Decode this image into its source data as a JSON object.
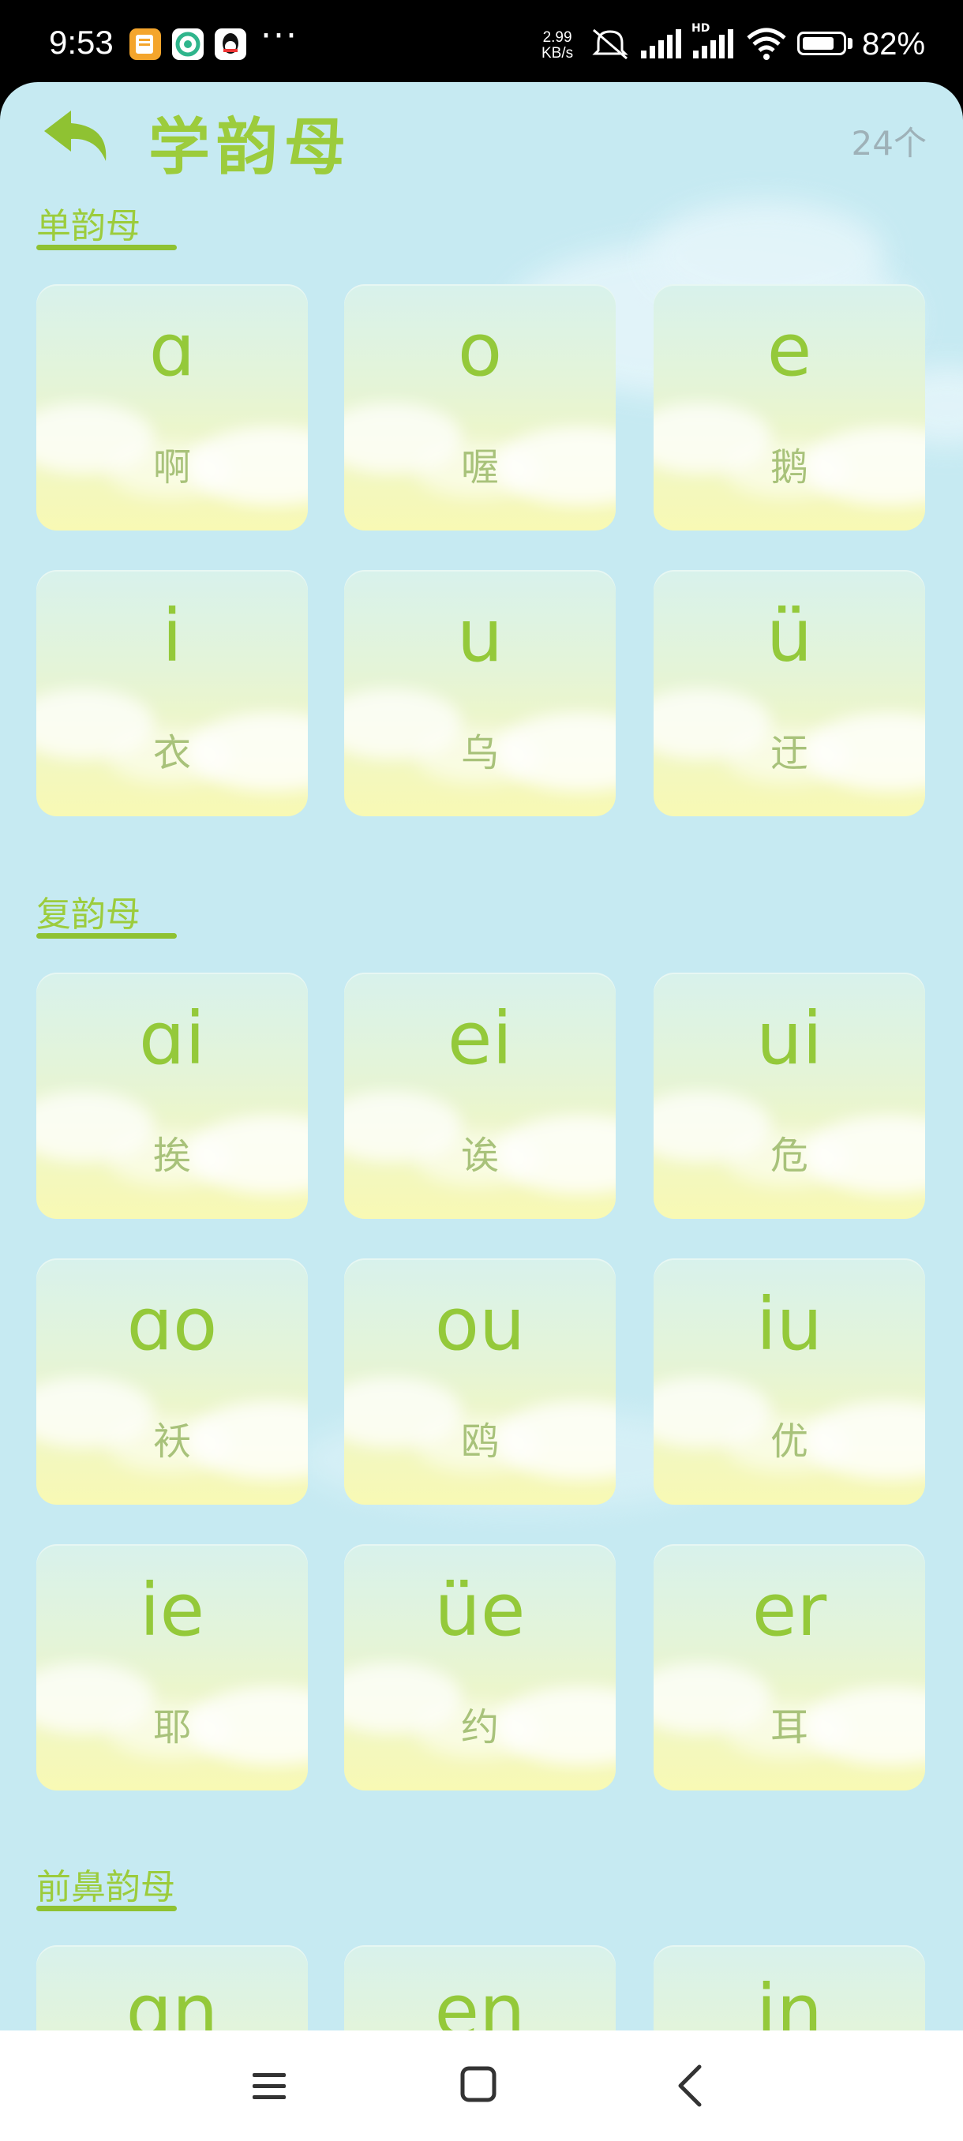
{
  "status_bar": {
    "time": "9:53",
    "network_speed_value": "2.99",
    "network_speed_unit": "KB/s",
    "more": "···",
    "battery_level": 0.82,
    "battery_pct": "82%",
    "hd_label": "HD"
  },
  "header": {
    "title": "学韵母",
    "count": "24个"
  },
  "sections": [
    {
      "title": "单韵母",
      "cards": [
        {
          "pinyin": "ɑ",
          "hanzi": "啊"
        },
        {
          "pinyin": "o",
          "hanzi": "喔"
        },
        {
          "pinyin": "e",
          "hanzi": "鹅"
        },
        {
          "pinyin": "i",
          "hanzi": "衣"
        },
        {
          "pinyin": "u",
          "hanzi": "乌"
        },
        {
          "pinyin": "ü",
          "hanzi": "迂"
        }
      ]
    },
    {
      "title": "复韵母",
      "cards": [
        {
          "pinyin": "ɑi",
          "hanzi": "挨"
        },
        {
          "pinyin": "ei",
          "hanzi": "诶"
        },
        {
          "pinyin": "ui",
          "hanzi": "危"
        },
        {
          "pinyin": "ɑo",
          "hanzi": "袄"
        },
        {
          "pinyin": "ou",
          "hanzi": "鸥"
        },
        {
          "pinyin": "iu",
          "hanzi": "优"
        },
        {
          "pinyin": "ie",
          "hanzi": "耶"
        },
        {
          "pinyin": "üe",
          "hanzi": "约"
        },
        {
          "pinyin": "er",
          "hanzi": "耳"
        }
      ]
    },
    {
      "title": "前鼻韵母",
      "cards": [
        {
          "pinyin": "ɑn",
          "hanzi": ""
        },
        {
          "pinyin": "en",
          "hanzi": ""
        },
        {
          "pinyin": "in",
          "hanzi": ""
        }
      ]
    }
  ],
  "nav": {
    "menu_icon": "menu-icon",
    "home_icon": "home-icon",
    "back_icon": "back-icon"
  },
  "colors": {
    "accent_green": "#9ccc3c",
    "background": "#c6eaf2"
  }
}
